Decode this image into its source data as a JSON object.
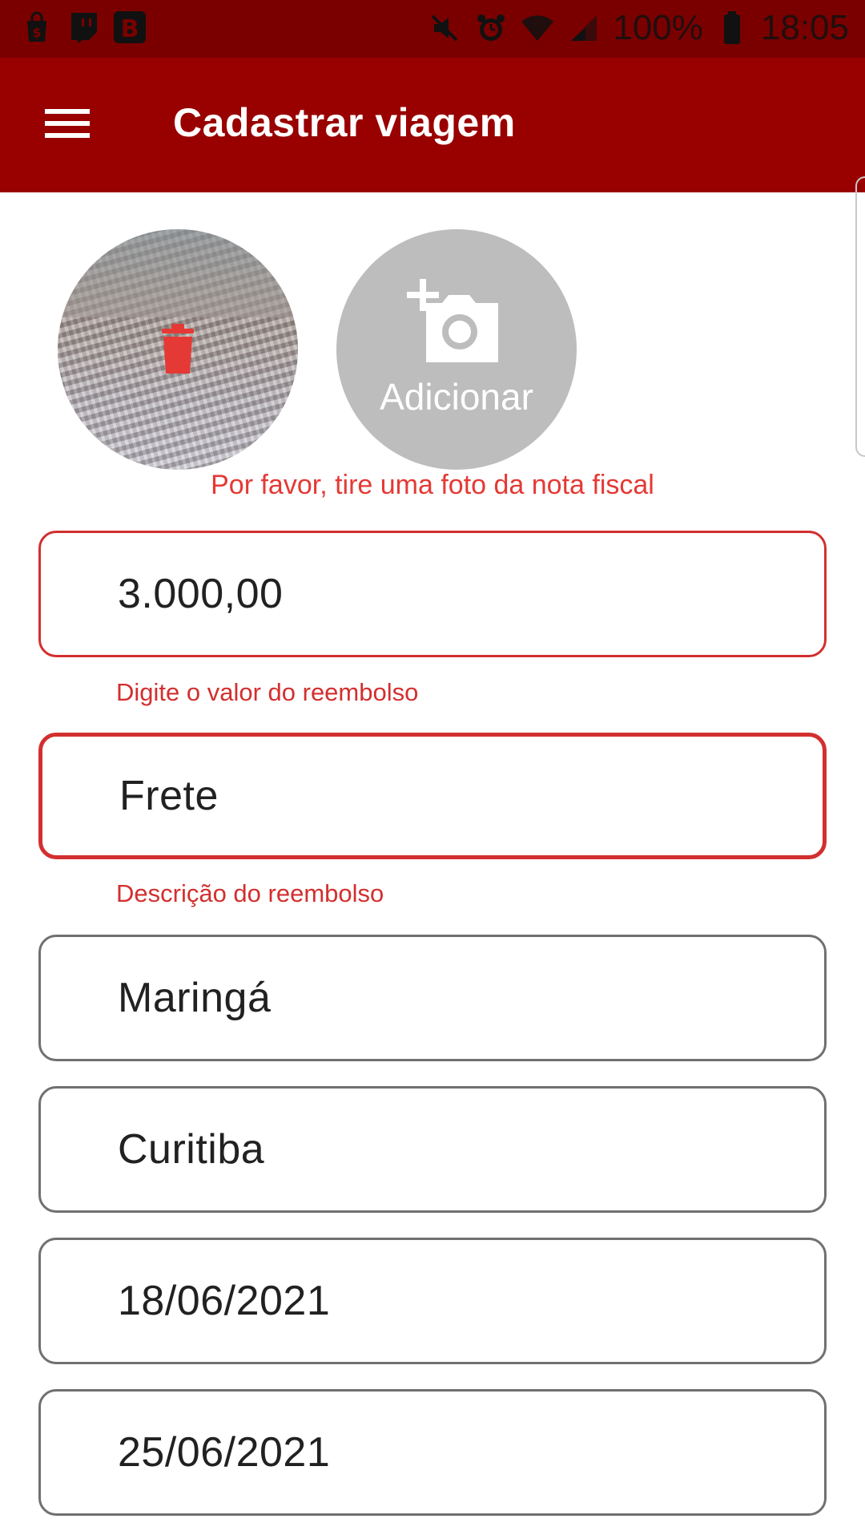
{
  "status_bar": {
    "apps": [
      "shopping-bag-icon",
      "twitch-icon",
      "b-app-icon"
    ],
    "icons": [
      "mute-icon",
      "alarm-icon",
      "wifi-icon",
      "signal-icon",
      "battery-icon"
    ],
    "battery": "100%",
    "time": "18:05"
  },
  "app_bar": {
    "title": "Cadastrar viagem",
    "menu_icon": "hamburger-menu-icon",
    "color": "#990000"
  },
  "photos": {
    "delete_icon": "trash-icon",
    "add_icon": "add-photo-camera-icon",
    "add_label": "Adicionar",
    "error": "Por favor, tire uma foto da nota fiscal"
  },
  "form": {
    "amount": {
      "value": "3.000,00",
      "helper": "Digite o valor do reembolso"
    },
    "description": {
      "value": "Frete",
      "helper": "Descrição do reembolso"
    },
    "origin": {
      "value": "Maringá"
    },
    "destination": {
      "value": "Curitiba"
    },
    "start_date": {
      "value": "18/06/2021"
    },
    "end_date": {
      "value": "25/06/2021"
    }
  },
  "colors": {
    "error": "#d32f2f",
    "status_bar": "#7a0000"
  }
}
